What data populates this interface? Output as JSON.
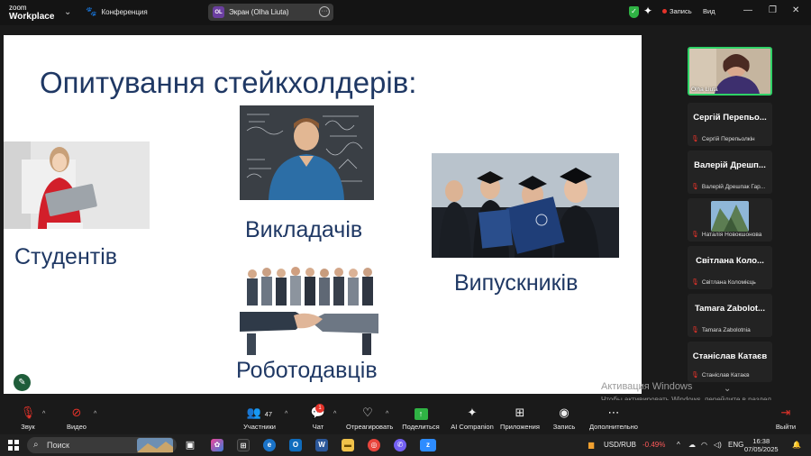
{
  "app": {
    "logo_line1": "zoom",
    "logo_line2": "Workplace"
  },
  "header": {
    "meeting_label": "Конференция",
    "screen_share_initials": "OL",
    "screen_share_label": "Экран (Olha Liuta)",
    "record_label": "Запись",
    "view_label": "Вид"
  },
  "slide": {
    "title": "Опитування стейкхолдерів:",
    "captions": {
      "students": "Студентів",
      "teachers": "Викладачів",
      "graduates": "Випускників",
      "employers": "Роботодавців"
    }
  },
  "participants": {
    "self": {
      "name": "Olha Liuta"
    },
    "tiles": [
      {
        "big": "Сергій Перепьо...",
        "small": "Сергій Перепьолкін",
        "has_thumb": false
      },
      {
        "big": "Валерій Дрешп...",
        "small": "Валерій Дрешпак Гар...",
        "has_thumb": false
      },
      {
        "big": "",
        "small": "Наталія Новокшонова",
        "has_thumb": true
      },
      {
        "big": "Світлана Коло...",
        "small": "Світлана Коломієць",
        "has_thumb": false
      },
      {
        "big": "Tamara Zabolot...",
        "small": "Tamara Zabolotnia",
        "has_thumb": false
      },
      {
        "big": "Станіслав Катаєв",
        "small": "Станіслав Катаєв",
        "has_thumb": false
      }
    ]
  },
  "activation": {
    "title": "Активация Windows",
    "text": "Чтобы активировать Windows, перейдите в раздел \"Параметры\"."
  },
  "toolbar": {
    "audio": "Звук",
    "video": "Видео",
    "participants": "Участники",
    "participants_count": "47",
    "chat": "Чат",
    "chat_badge": "1",
    "react": "Отреагировать",
    "share": "Поделиться",
    "ai": "AI Companion",
    "apps": "Приложения",
    "record": "Запись",
    "more": "Дополнительно",
    "leave": "Выйти"
  },
  "taskbar": {
    "search_placeholder": "Поиск",
    "currency": "USD/RUB",
    "currency_change": "-0.49%",
    "lang": "ENG",
    "time": "16:38",
    "date": "07/05/2025"
  },
  "colors": {
    "slide_text": "#1f3864",
    "active_speaker": "#2fd267",
    "share_green": "#2fb344",
    "alert_red": "#e5332a"
  }
}
